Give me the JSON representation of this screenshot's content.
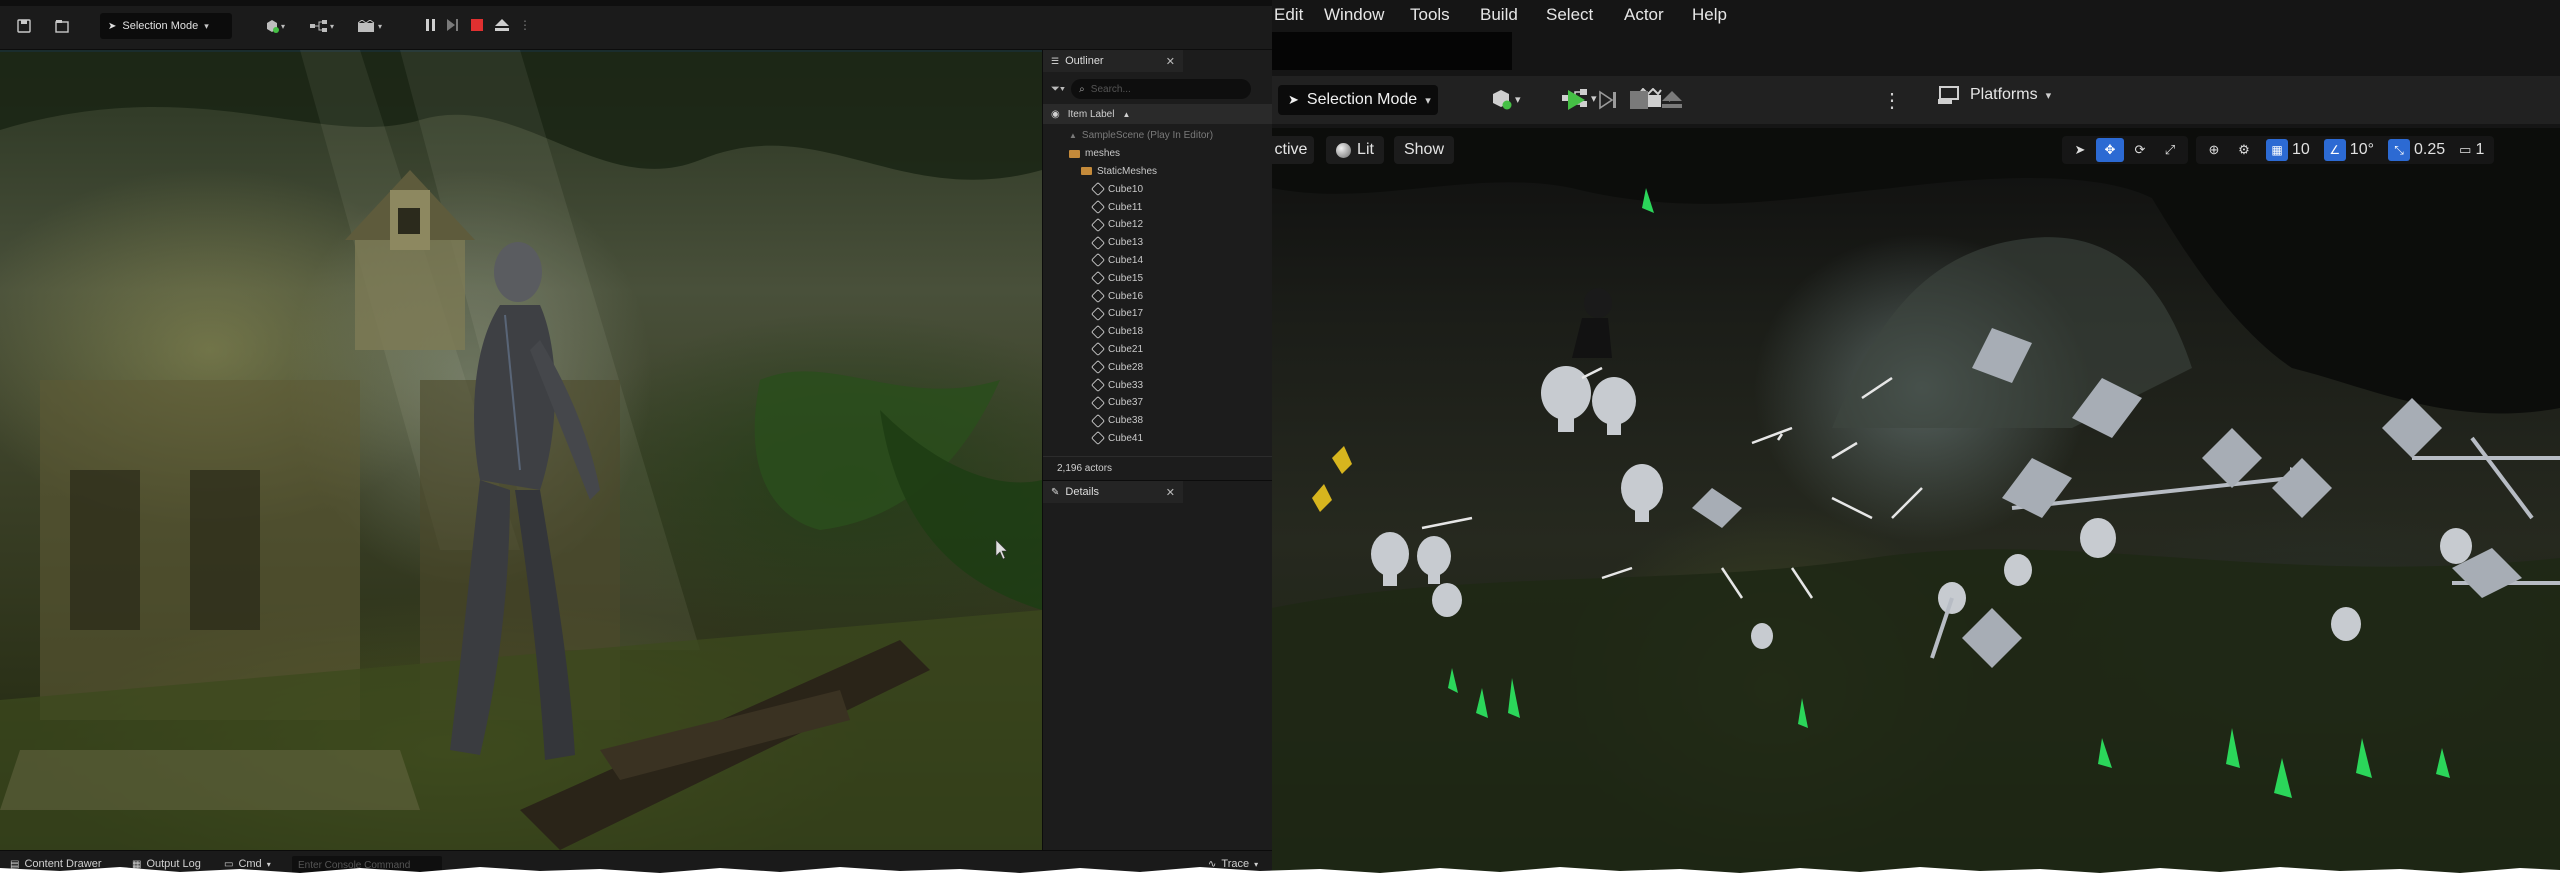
{
  "left_editor": {
    "toolbar": {
      "mode_label": "Selection Mode"
    },
    "outliner": {
      "tab_label": "Outliner",
      "search_placeholder": "Search...",
      "column_header": "Item Label",
      "items": [
        {
          "label": "SampleScene (Play In Editor)",
          "kind": "world",
          "indent": 0
        },
        {
          "label": "meshes",
          "kind": "folder",
          "indent": 1
        },
        {
          "label": "StaticMeshes",
          "kind": "folder",
          "indent": 2
        },
        {
          "label": "Cube10",
          "kind": "mesh",
          "indent": 3
        },
        {
          "label": "Cube11",
          "kind": "mesh",
          "indent": 3
        },
        {
          "label": "Cube12",
          "kind": "mesh",
          "indent": 3
        },
        {
          "label": "Cube13",
          "kind": "mesh",
          "indent": 3
        },
        {
          "label": "Cube14",
          "kind": "mesh",
          "indent": 3
        },
        {
          "label": "Cube15",
          "kind": "mesh",
          "indent": 3
        },
        {
          "label": "Cube16",
          "kind": "mesh",
          "indent": 3
        },
        {
          "label": "Cube17",
          "kind": "mesh",
          "indent": 3
        },
        {
          "label": "Cube18",
          "kind": "mesh",
          "indent": 3
        },
        {
          "label": "Cube21",
          "kind": "mesh",
          "indent": 3
        },
        {
          "label": "Cube28",
          "kind": "mesh",
          "indent": 3
        },
        {
          "label": "Cube33",
          "kind": "mesh",
          "indent": 3
        },
        {
          "label": "Cube37",
          "kind": "mesh",
          "indent": 3
        },
        {
          "label": "Cube38",
          "kind": "mesh",
          "indent": 3
        },
        {
          "label": "Cube41",
          "kind": "mesh",
          "indent": 3
        }
      ],
      "actor_count": "2,196 actors"
    },
    "details": {
      "tab_label": "Details"
    },
    "bottom_bar": {
      "content_drawer": "Content Drawer",
      "output_log": "Output Log",
      "cmd": "Cmd",
      "cmd_placeholder": "Enter Console Command",
      "trace": "Trace"
    }
  },
  "right_editor": {
    "menu": [
      "Edit",
      "Window",
      "Tools",
      "Build",
      "Select",
      "Actor",
      "Help"
    ],
    "toolbar": {
      "mode_label": "Selection Mode",
      "platforms_label": "Platforms"
    },
    "viewport_toolbar": {
      "perspective_label": "ctive",
      "lit_label": "Lit",
      "show_label": "Show",
      "grid_snap": "10",
      "rotation_snap": "10°",
      "scale_snap": "0.25",
      "camera_speed": "1"
    }
  },
  "colors": {
    "accent_blue": "#2c6ad3",
    "play_green": "#45c045",
    "stop_red": "#e03030",
    "folder_orange": "#c48a3a"
  }
}
